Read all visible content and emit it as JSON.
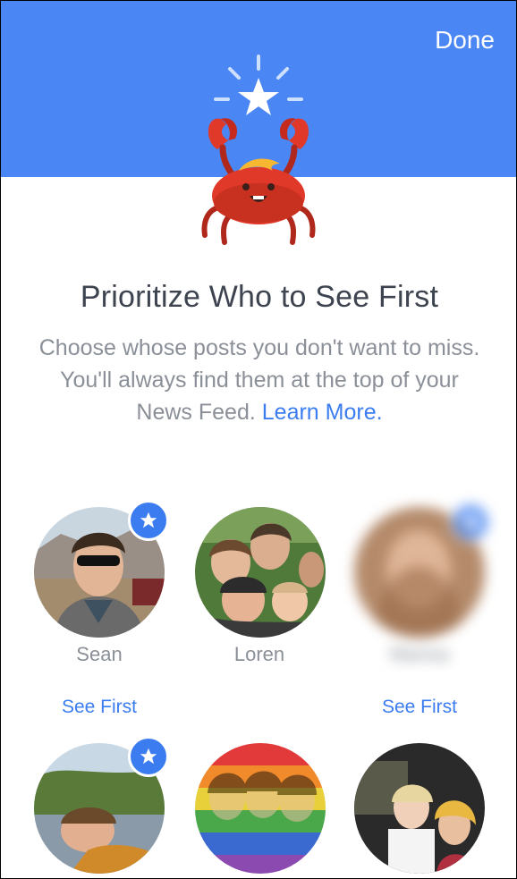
{
  "header": {
    "done_label": "Done",
    "color": "#4a86f4"
  },
  "intro": {
    "title": "Prioritize Who to See First",
    "description": "Choose whose posts you don't want to miss. You'll always find them at the top of your News Feed.",
    "learn_more": "Learn More."
  },
  "friends": [
    {
      "name": "Sean",
      "action": "See First",
      "starred": true
    },
    {
      "name": "Loren",
      "action": "",
      "starred": false
    },
    {
      "name": "Marisa",
      "action": "See First",
      "starred": true
    },
    {
      "name": "",
      "action": "",
      "starred": true
    },
    {
      "name": "",
      "action": "",
      "starred": false
    },
    {
      "name": "",
      "action": "",
      "starred": false
    }
  ],
  "accent_color": "#3b7df0"
}
